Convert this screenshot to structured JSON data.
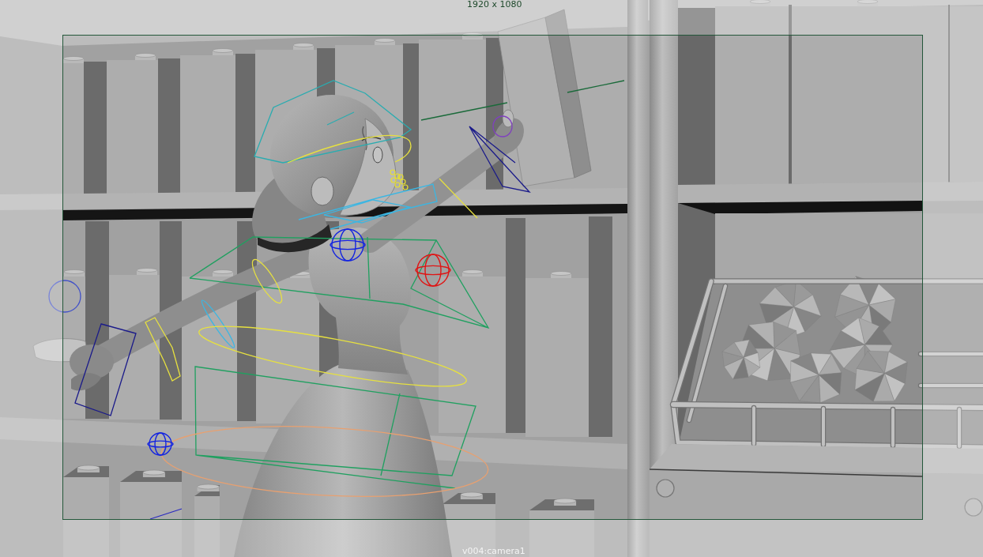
{
  "viewport": {
    "resolution_label": "1920 x 1080",
    "camera_label": "v004:camera1"
  }
}
